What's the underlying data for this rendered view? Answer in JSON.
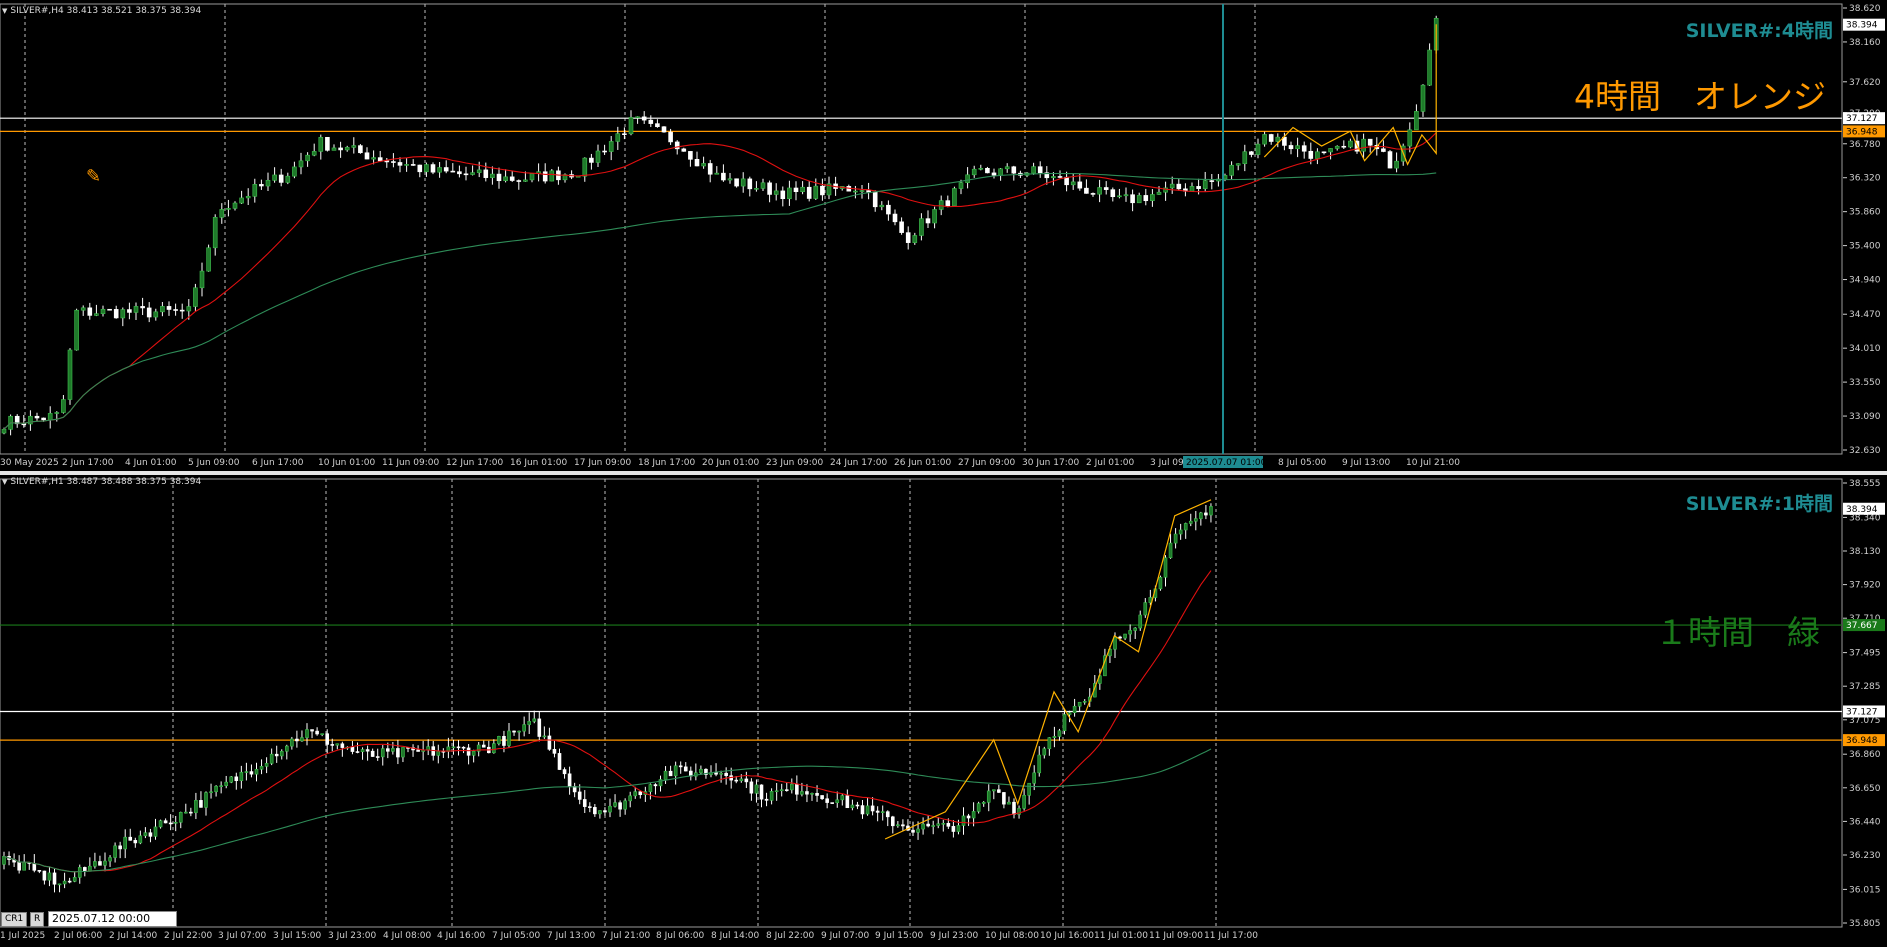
{
  "pane1": {
    "symbol_info": "SILVER#,H4  38.413 38.521 38.375 38.394",
    "title": "SILVER#:4時間",
    "note": "4時間　オレンジ",
    "price_labels": [
      "38.620",
      "38.160",
      "37.620",
      "37.200",
      "36.780",
      "36.320",
      "35.860",
      "35.400",
      "34.940",
      "34.470",
      "34.010",
      "33.550",
      "33.090",
      "32.630"
    ],
    "time_labels": [
      "30 May 2025",
      "2 Jun 17:00",
      "4 Jun 01:00",
      "5 Jun 09:00",
      "6 Jun 17:00",
      "10 Jun 01:00",
      "11 Jun 09:00",
      "12 Jun 17:00",
      "16 Jun 01:00",
      "17 Jun 09:00",
      "18 Jun 17:00",
      "20 Jun 01:00",
      "23 Jun 09:00",
      "24 Jun 17:00",
      "26 Jun 01:00",
      "27 Jun 09:00",
      "30 Jun 17:00",
      "2 Jul 01:00",
      "3 Jul 09",
      "8 Jul 05:00",
      "9 Jul 13:00",
      "10 Jul 21:00"
    ],
    "crosshair_label": "2025.07.07 01:00",
    "current_price": "38.394",
    "white_level": "37.127",
    "orange_level": "36.948",
    "price_min": 32.63,
    "price_max": 38.62
  },
  "pane2": {
    "symbol_info": "SILVER#,H1  38.487 38.488 38.375 38.394",
    "title": "SILVER#:1時間",
    "note": "１時間　緑",
    "price_labels": [
      "38.555",
      "38.340",
      "38.130",
      "37.920",
      "37.710",
      "37.495",
      "37.285",
      "37.075",
      "36.860",
      "36.650",
      "36.440",
      "36.230",
      "36.015",
      "35.805"
    ],
    "time_labels": [
      "1 Jul 2025",
      "2 Jul 06:00",
      "2 Jul 14:00",
      "2 Jul 22:00",
      "3 Jul 07:00",
      "3 Jul 15:00",
      "3 Jul 23:00",
      "4 Jul 08:00",
      "4 Jul 16:00",
      "7 Jul 05:00",
      "7 Jul 13:00",
      "7 Jul 21:00",
      "8 Jul 06:00",
      "8 Jul 14:00",
      "8 Jul 22:00",
      "9 Jul 07:00",
      "9 Jul 15:00",
      "9 Jul 23:00",
      "10 Jul 08:00",
      "10 Jul 16:00",
      "11 Jul 01:00",
      "11 Jul 09:00",
      "11 Jul 17:00"
    ],
    "current_price": "38.394",
    "green_level": "37.667",
    "white_level": "37.127",
    "orange_level": "36.948",
    "price_min": 35.805,
    "price_max": 38.555
  },
  "controls": {
    "btn_a": "CR1",
    "btn_b": "R",
    "date_value": "2025.07.12 00:00"
  },
  "colors": {
    "orange": "#ff9900",
    "green": "#1a7a1a",
    "teal": "#1e8c92",
    "red_ma": "#e01010",
    "green_ma": "#2e8b57",
    "zigzag": "#ffb300"
  }
}
